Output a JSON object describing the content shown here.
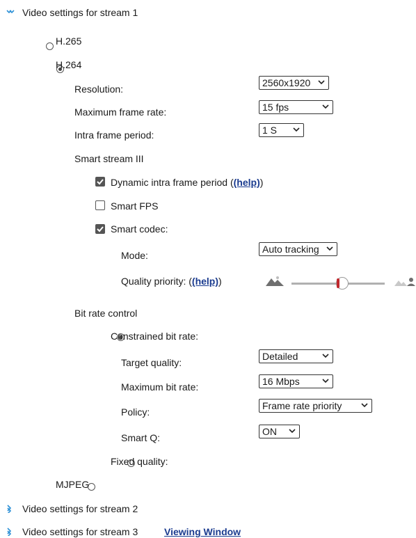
{
  "stream1": {
    "label": "Video settings for stream 1",
    "codecs": {
      "h265": "H.265",
      "h264": "H.264",
      "mjpeg": "MJPEG"
    },
    "resolution": {
      "label": "Resolution:",
      "value": "2560x1920"
    },
    "frame_rate": {
      "label": "Maximum frame rate:",
      "value": "15 fps"
    },
    "intra_period": {
      "label": "Intra frame period:",
      "value": "1 S"
    },
    "smart_stream": {
      "title": "Smart stream III",
      "dynamic_intra": {
        "label_pre": "Dynamic intra frame period (",
        "help": "(help)",
        "label_post": ")",
        "checked": true
      },
      "smart_fps": {
        "label": "Smart FPS",
        "checked": false
      },
      "smart_codec": {
        "label": "Smart codec:",
        "checked": true
      },
      "mode": {
        "label": "Mode:",
        "value": "Auto tracking"
      },
      "quality_priority": {
        "label_pre": "Quality priority: (",
        "help": "(help)",
        "label_post": ")",
        "level": 0.37
      }
    },
    "bitrate": {
      "title": "Bit rate control",
      "constrained": {
        "label": "Constrained bit rate:",
        "selected": true
      },
      "target_quality": {
        "label": "Target quality:",
        "value": "Detailed"
      },
      "max_bitrate": {
        "label": "Maximum bit rate:",
        "value": "16 Mbps"
      },
      "policy": {
        "label": "Policy:",
        "value": "Frame rate priority"
      },
      "smart_q": {
        "label": "Smart Q:",
        "value": "ON"
      },
      "fixed": {
        "label": "Fixed quality:",
        "selected": false
      }
    }
  },
  "stream2": {
    "label": "Video settings for stream 2"
  },
  "stream3": {
    "label": "Video settings for stream 3"
  },
  "viewing_window": "Viewing Window",
  "colors": {
    "accent": "#2a8fd6",
    "link": "#1a3b8f",
    "slider_handle": "#c0282d"
  }
}
